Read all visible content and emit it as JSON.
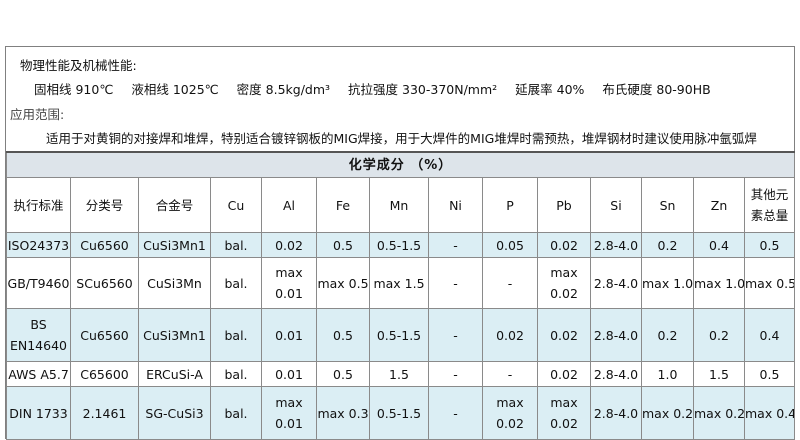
{
  "info": {
    "heading": "物理性能及机械性能:",
    "props": [
      "固相线 910℃",
      "液相线 1025℃",
      "密度 8.5kg/dm³",
      "抗拉强度 330-370N/mm²",
      "延展率 40%",
      "布氏硬度 80-90HB"
    ],
    "application_heading": "应用范围:",
    "application_text": "适用于对黄铜的对接焊和堆焊，特别适合镀锌钢板的MIG焊接，用于大焊件的MIG堆焊时需预热，堆焊钢材时建议使用脉冲氩弧焊"
  },
  "table": {
    "title": "化学成分 （%）",
    "headers": [
      "执行标准",
      "分类号",
      "合金号",
      "Cu",
      "Al",
      "Fe",
      "Mn",
      "Ni",
      "P",
      "Pb",
      "Si",
      "Sn",
      "Zn",
      "其他元素总量"
    ],
    "rows": [
      [
        "ISO24373",
        "Cu6560",
        "CuSi3Mn1",
        "bal.",
        "0.02",
        "0.5",
        "0.5-1.5",
        "-",
        "0.05",
        "0.02",
        "2.8-4.0",
        "0.2",
        "0.4",
        "0.5"
      ],
      [
        "GB/T9460",
        "SCu6560",
        "CuSi3Mn",
        "bal.",
        "max 0.01",
        "max 0.5",
        "max 1.5",
        "-",
        "-",
        "max 0.02",
        "2.8-4.0",
        "max 1.0",
        "max 1.0",
        "max 0.5"
      ],
      [
        "BS EN14640",
        "Cu6560",
        "CuSi3Mn1",
        "bal.",
        "0.01",
        "0.5",
        "0.5-1.5",
        "-",
        "0.02",
        "0.02",
        "2.8-4.0",
        "0.2",
        "0.2",
        "0.4"
      ],
      [
        "AWS A5.7",
        "C65600",
        "ERCuSi-A",
        "bal.",
        "0.01",
        "0.5",
        "1.5",
        "-",
        "-",
        "0.02",
        "2.8-4.0",
        "1.0",
        "1.5",
        "0.5"
      ],
      [
        "DIN 1733",
        "2.1461",
        "SG-CuSi3",
        "bal.",
        "max 0.01",
        "max 0.3",
        "0.5-1.5",
        "-",
        "max 0.02",
        "max 0.02",
        "2.8-4.0",
        "max 0.2",
        "max 0.2",
        "max 0.4"
      ]
    ]
  }
}
